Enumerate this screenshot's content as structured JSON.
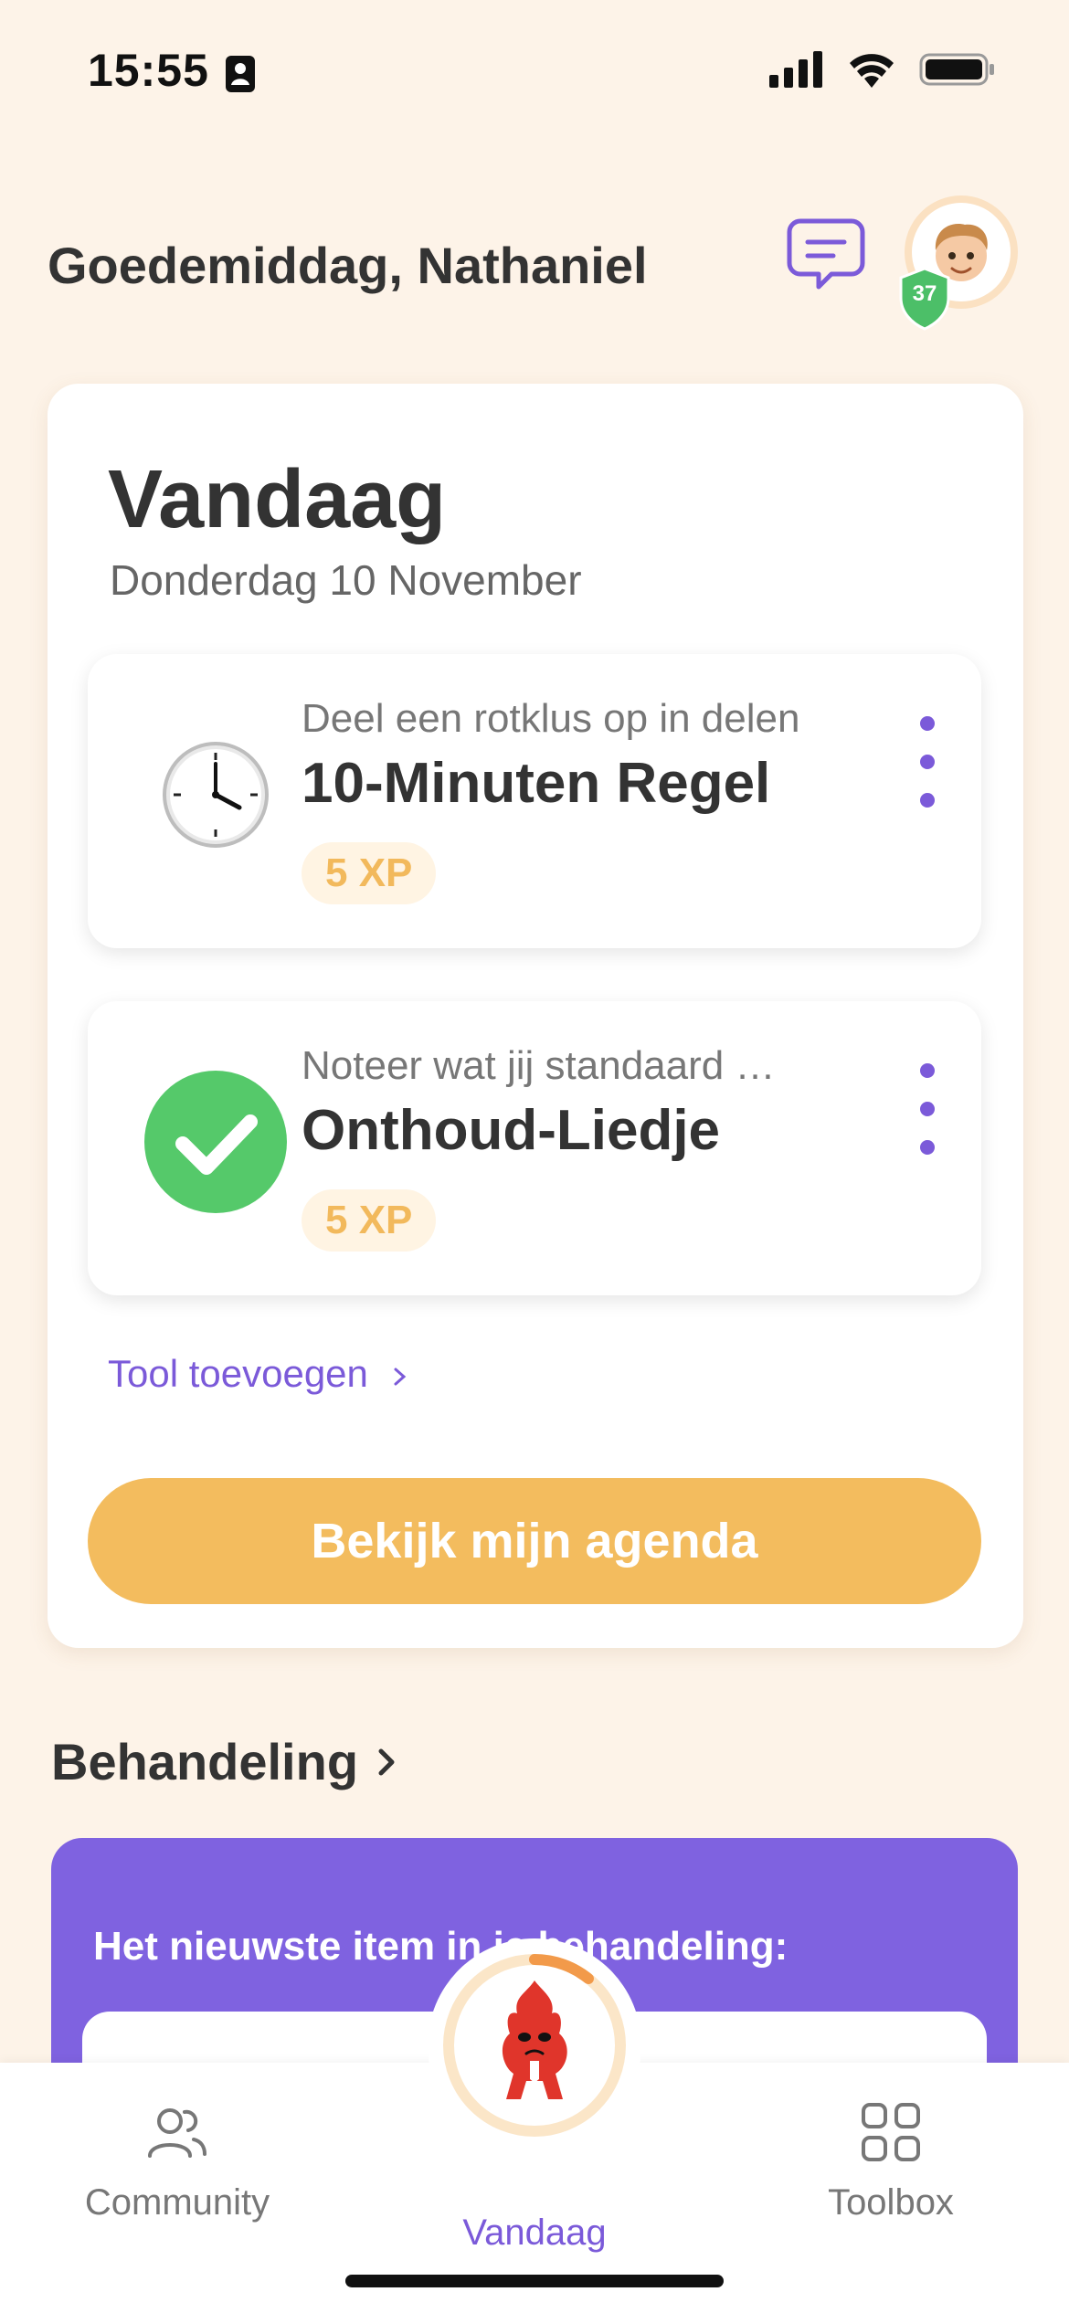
{
  "status_bar": {
    "time": "15:55"
  },
  "header": {
    "greeting": "Goedemiddag, Nathaniel",
    "level": "37"
  },
  "today": {
    "title": "Vandaag",
    "date": "Donderdag 10 November",
    "tools": [
      {
        "subtitle": "Deel een rotklus op in delen",
        "title": "10-Minuten Regel",
        "xp": "5 XP",
        "icon": "clock-icon"
      },
      {
        "subtitle": "Noteer wat jij standaard …",
        "title": "Onthoud-Liedje",
        "xp": "5 XP",
        "icon": "checkmark-icon"
      }
    ],
    "add_tool_label": "Tool toevoegen",
    "agenda_button": "Bekijk mijn agenda"
  },
  "treatment": {
    "heading": "Behandeling",
    "latest_text": "Het nieuwste item in je behandeling:"
  },
  "nav": {
    "items": [
      {
        "label": "Community",
        "icon": "community-icon"
      },
      {
        "label": "Vandaag",
        "icon": "mascot-icon"
      },
      {
        "label": "Toolbox",
        "icon": "toolbox-icon"
      }
    ]
  },
  "colors": {
    "accent": "#7b5ad9",
    "background": "#fdf3e8",
    "button": "#f3bc5e",
    "xp": "#f2b95c",
    "purple_card": "#7f62e0",
    "success": "#55c96a"
  }
}
